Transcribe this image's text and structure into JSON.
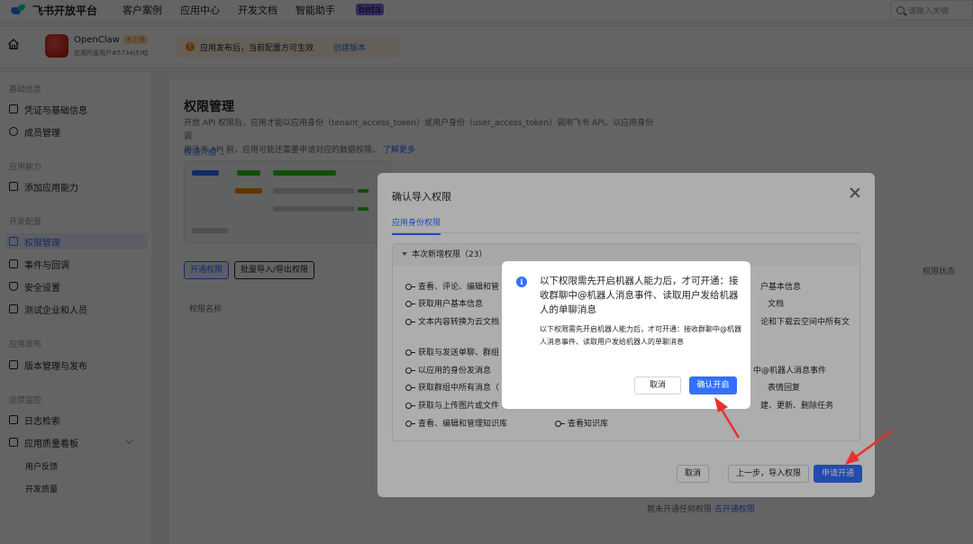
{
  "topbar": {
    "logo_text": "飞书开放平台",
    "nav": [
      "客户案例",
      "应用中心",
      "开发文档",
      "智能助手"
    ],
    "beta_badge": "beta",
    "search_placeholder": "请输入关键"
  },
  "app": {
    "name": "OpenClaw",
    "status_badge": "未上线",
    "sub": "应用所属用户#5734(5)哈",
    "notice_text": "应用发布后，当前配置方可生效",
    "notice_link": "创建版本"
  },
  "sidebar": {
    "sections": [
      {
        "title": "基础信息",
        "items": [
          "凭证与基础信息",
          "成员管理"
        ]
      },
      {
        "title": "应用能力",
        "items": [
          "添加应用能力"
        ]
      },
      {
        "title": "开发配置",
        "items": [
          "权限管理",
          "事件与回调",
          "安全设置",
          "测试企业和人员"
        ]
      },
      {
        "title": "应用发布",
        "items": [
          "版本管理与发布"
        ]
      },
      {
        "title": "运营监控",
        "items": [
          "日志检索",
          "应用质量看板"
        ]
      }
    ],
    "active_item": "权限管理",
    "sub_items": [
      "用户反馈",
      "开发质量"
    ]
  },
  "main": {
    "title": "权限管理",
    "desc_line1": "开放 API 权限后，应用才能以应用身份（tenant_access_token）或用户身份（user_access_token）调用飞书 API。以应用身份调",
    "desc_line2": "用飞书 API 前，应用可能还需要申请对应的数据权限。",
    "desc_link": "了解更多",
    "intro_link": "权限介绍",
    "open_permission_button": "开通权限",
    "import_export_button": "批量导入/导出权限",
    "column_header": "权限名称",
    "right_fragment": "权限状态",
    "bottom_note": "暂未开通任何权限",
    "bottom_link": "去开通权限"
  },
  "dialog": {
    "title": "确认导入权限",
    "tab": "应用身份权限",
    "section_header": "本次新增权限（23）",
    "permissions_left": [
      "查看、评论、编辑和管",
      "获取用户基本信息",
      "文本内容转换为云文档",
      "获取与发送单聊、群组",
      "以应用的身份发消息",
      "获取群组中所有消息（",
      "获取与上传图片或文件",
      "查看、编辑和管理知识库"
    ],
    "permissions_mid": [
      "查看知识库"
    ],
    "permissions_right": [
      "户基本信息",
      "文档",
      "论和下载云空间中所有文",
      "中@机器人消息事件",
      "表情回复",
      "建、更新、删除任务"
    ],
    "cancel_button": "取消",
    "back_button": "上一步，导入权限",
    "apply_button": "申请开通"
  },
  "popup": {
    "title": "以下权限需先开启机器人能力后，才可开通：接收群聊中@机器人消息事件、读取用户发给机器人的单聊消息",
    "body": "以下权限需先开启机器人能力后，才可开通：接收群聊中@机器人消息事件、读取用户发给机器人的单聊消息",
    "cancel_button": "取消",
    "confirm_button": "确认开启"
  },
  "colors": {
    "brand_blue": "#3370ff",
    "annotation_red": "#e5322d",
    "warning_orange": "#ff8800"
  }
}
